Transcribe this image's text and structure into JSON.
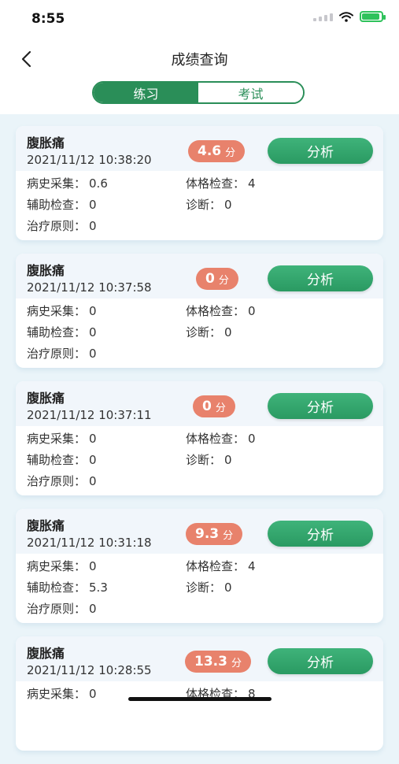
{
  "status_bar": {
    "time": "8:55"
  },
  "nav": {
    "title": "成绩查询",
    "back_icon": "chevron-left-icon"
  },
  "tabs": [
    {
      "label": "练习",
      "active": true
    },
    {
      "label": "考试",
      "active": false
    }
  ],
  "colors": {
    "primary": "#2a8e58",
    "score_badge": "#e8826c",
    "page_bg": "#eaf4f9"
  },
  "records": [
    {
      "name": "腹胀痛",
      "time": "2021/11/12 10:38:20",
      "score": "4.6",
      "unit": "分",
      "button": "分析",
      "fields": [
        {
          "label": "病史采集：",
          "value": "0.6"
        },
        {
          "label": "体格检查：",
          "value": "4"
        },
        {
          "label": "辅助检查：",
          "value": "0"
        },
        {
          "label": "诊断：",
          "value": "0"
        },
        {
          "label": "治疗原则：",
          "value": "0"
        }
      ]
    },
    {
      "name": "腹胀痛",
      "time": "2021/11/12 10:37:58",
      "score": "0",
      "unit": "分",
      "button": "分析",
      "fields": [
        {
          "label": "病史采集：",
          "value": "0"
        },
        {
          "label": "体格检查：",
          "value": "0"
        },
        {
          "label": "辅助检查：",
          "value": "0"
        },
        {
          "label": "诊断：",
          "value": "0"
        },
        {
          "label": "治疗原则：",
          "value": "0"
        }
      ]
    },
    {
      "name": "腹胀痛",
      "time": "2021/11/12 10:37:11",
      "score": "0",
      "unit": "分",
      "button": "分析",
      "fields": [
        {
          "label": "病史采集：",
          "value": "0"
        },
        {
          "label": "体格检查：",
          "value": "0"
        },
        {
          "label": "辅助检查：",
          "value": "0"
        },
        {
          "label": "诊断：",
          "value": "0"
        },
        {
          "label": "治疗原则：",
          "value": "0"
        }
      ]
    },
    {
      "name": "腹胀痛",
      "time": "2021/11/12 10:31:18",
      "score": "9.3",
      "unit": "分",
      "button": "分析",
      "fields": [
        {
          "label": "病史采集：",
          "value": "0"
        },
        {
          "label": "体格检查：",
          "value": "4"
        },
        {
          "label": "辅助检查：",
          "value": "5.3"
        },
        {
          "label": "诊断：",
          "value": "0"
        },
        {
          "label": "治疗原则：",
          "value": "0"
        }
      ]
    },
    {
      "name": "腹胀痛",
      "time": "2021/11/12 10:28:55",
      "score": "13.3",
      "unit": "分",
      "button": "分析",
      "fields": [
        {
          "label": "病史采集：",
          "value": "0"
        },
        {
          "label": "体格检查：",
          "value": "8"
        }
      ]
    }
  ]
}
